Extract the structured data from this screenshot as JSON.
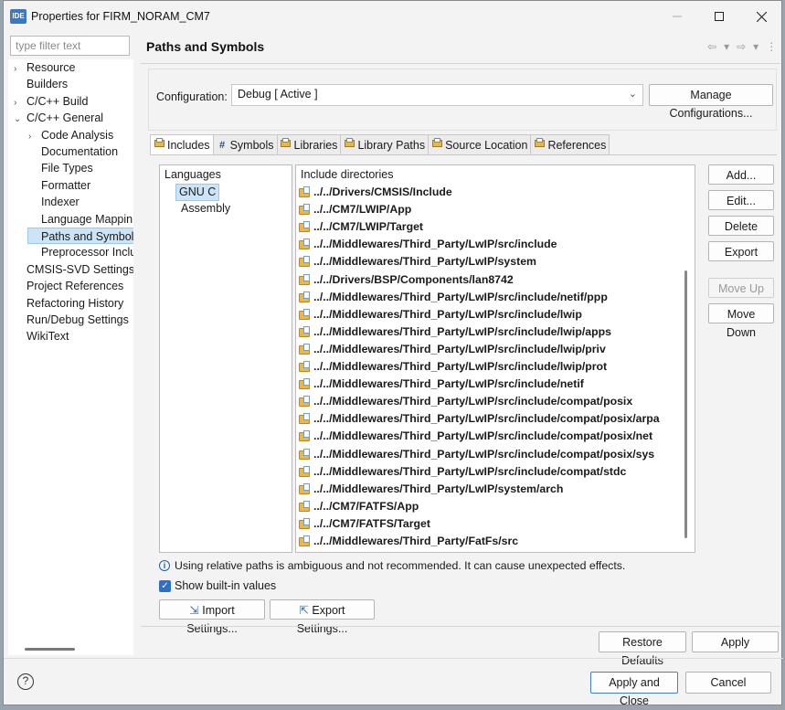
{
  "window": {
    "title": "Properties for FIRM_NORAM_CM7",
    "app_icon_text": "IDE"
  },
  "left": {
    "filter_placeholder": "type filter text",
    "tree": [
      {
        "label": "Resource",
        "indent": 0,
        "arrow": "›"
      },
      {
        "label": "Builders",
        "indent": 0,
        "arrow": ""
      },
      {
        "label": "C/C++ Build",
        "indent": 0,
        "arrow": "›"
      },
      {
        "label": "C/C++ General",
        "indent": 0,
        "arrow": "⌄"
      },
      {
        "label": "Code Analysis",
        "indent": 1,
        "arrow": "›"
      },
      {
        "label": "Documentation",
        "indent": 1,
        "arrow": ""
      },
      {
        "label": "File Types",
        "indent": 1,
        "arrow": ""
      },
      {
        "label": "Formatter",
        "indent": 1,
        "arrow": ""
      },
      {
        "label": "Indexer",
        "indent": 1,
        "arrow": ""
      },
      {
        "label": "Language Mappin",
        "indent": 1,
        "arrow": ""
      },
      {
        "label": "Paths and Symbols",
        "indent": 1,
        "arrow": "",
        "selected": true
      },
      {
        "label": "Preprocessor Inclu",
        "indent": 1,
        "arrow": ""
      },
      {
        "label": "CMSIS-SVD Settings",
        "indent": 0,
        "arrow": ""
      },
      {
        "label": "Project References",
        "indent": 0,
        "arrow": ""
      },
      {
        "label": "Refactoring History",
        "indent": 0,
        "arrow": ""
      },
      {
        "label": "Run/Debug Settings",
        "indent": 0,
        "arrow": ""
      },
      {
        "label": "WikiText",
        "indent": 0,
        "arrow": ""
      }
    ]
  },
  "main": {
    "title": "Paths and Symbols",
    "configuration_label": "Configuration:",
    "configuration_value": "Debug  [ Active ]",
    "manage_button": "Manage Configurations...",
    "tabs": [
      {
        "label": "Includes",
        "icon": "includes-icon",
        "active": true
      },
      {
        "label": "Symbols",
        "icon": "hash-icon"
      },
      {
        "label": "Libraries",
        "icon": "library-icon"
      },
      {
        "label": "Library Paths",
        "icon": "library-path-icon"
      },
      {
        "label": "Source Location",
        "icon": "source-folder-icon"
      },
      {
        "label": "References",
        "icon": "references-icon"
      }
    ],
    "languages_header": "Languages",
    "languages": [
      "GNU C",
      "Assembly"
    ],
    "selected_language": 0,
    "directories_header": "Include directories",
    "directories": [
      "../../Drivers/CMSIS/Include",
      "../../CM7/LWIP/App",
      "../../CM7/LWIP/Target",
      "../../Middlewares/Third_Party/LwIP/src/include",
      "../../Middlewares/Third_Party/LwIP/system",
      "../../Drivers/BSP/Components/lan8742",
      "../../Middlewares/Third_Party/LwIP/src/include/netif/ppp",
      "../../Middlewares/Third_Party/LwIP/src/include/lwip",
      "../../Middlewares/Third_Party/LwIP/src/include/lwip/apps",
      "../../Middlewares/Third_Party/LwIP/src/include/lwip/priv",
      "../../Middlewares/Third_Party/LwIP/src/include/lwip/prot",
      "../../Middlewares/Third_Party/LwIP/src/include/netif",
      "../../Middlewares/Third_Party/LwIP/src/include/compat/posix",
      "../../Middlewares/Third_Party/LwIP/src/include/compat/posix/arpa",
      "../../Middlewares/Third_Party/LwIP/src/include/compat/posix/net",
      "../../Middlewares/Third_Party/LwIP/src/include/compat/posix/sys",
      "../../Middlewares/Third_Party/LwIP/src/include/compat/stdc",
      "../../Middlewares/Third_Party/LwIP/system/arch",
      "../../CM7/FATFS/App",
      "../../CM7/FATFS/Target",
      "../../Middlewares/Third_Party/FatFs/src"
    ],
    "side_buttons": {
      "add": "Add...",
      "edit": "Edit...",
      "delete": "Delete",
      "export": "Export",
      "move_up": "Move Up",
      "move_down": "Move Down"
    },
    "info_text": "Using relative paths is ambiguous and not recommended. It can cause unexpected effects.",
    "show_builtin_label": "Show built-in values",
    "show_builtin_checked": true,
    "import_button": "Import Settings...",
    "export_button": "Export Settings..."
  },
  "footer": {
    "restore_defaults": "Restore Defaults",
    "apply": "Apply",
    "apply_and_close": "Apply and Close",
    "cancel": "Cancel"
  }
}
